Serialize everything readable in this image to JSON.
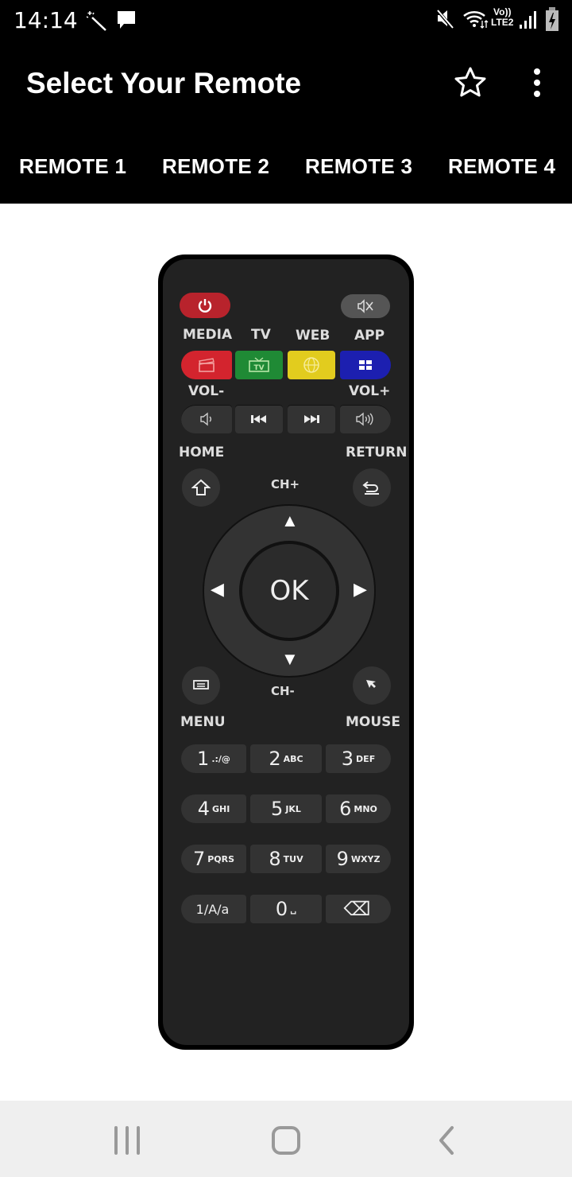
{
  "status_bar": {
    "time": "14:14",
    "left_icons": [
      "magic-wand-icon",
      "message-icon"
    ],
    "right_icons": [
      "mute-icon",
      "wifi-icon",
      "volte-lte2-icon",
      "signal-icon",
      "battery-charging-icon"
    ],
    "network_label_top": "Vo))",
    "network_label_bottom": "LTE2"
  },
  "app_bar": {
    "title": "Select Your Remote",
    "actions": [
      "star-icon",
      "more-vert-icon"
    ]
  },
  "tabs": [
    {
      "label": "REMOTE 1"
    },
    {
      "label": "REMOTE 2"
    },
    {
      "label": "REMOTE 3"
    },
    {
      "label": "REMOTE 4"
    }
  ],
  "remote": {
    "labels": {
      "media": "MEDIA",
      "tv": "TV",
      "web": "WEB",
      "app": "APP",
      "vol_minus": "VOL-",
      "vol_plus": "VOL+",
      "home": "HOME",
      "return": "RETURN",
      "ch_plus": "CH+",
      "ch_minus": "CH-",
      "menu": "MENU",
      "mouse": "MOUSE",
      "ok": "OK"
    },
    "color_buttons": [
      {
        "name": "media",
        "color": "#d3242e"
      },
      {
        "name": "tv",
        "color": "#1f8a35"
      },
      {
        "name": "web",
        "color": "#e2cc1e"
      },
      {
        "name": "app",
        "color": "#1c1fb0"
      }
    ],
    "power_color": "#b8232c",
    "keypad": [
      {
        "digit": "1",
        "sub": ".:/@"
      },
      {
        "digit": "2",
        "sub": "ABC"
      },
      {
        "digit": "3",
        "sub": "DEF"
      },
      {
        "digit": "4",
        "sub": "GHI"
      },
      {
        "digit": "5",
        "sub": "JKL"
      },
      {
        "digit": "6",
        "sub": "MNO"
      },
      {
        "digit": "7",
        "sub": "PQRS"
      },
      {
        "digit": "8",
        "sub": "TUV"
      },
      {
        "digit": "9",
        "sub": "WXYZ"
      },
      {
        "digit": "1/A/a",
        "sub": ""
      },
      {
        "digit": "0",
        "sub": "␣"
      },
      {
        "digit": "⌫",
        "sub": ""
      }
    ]
  },
  "nav_bar": {
    "buttons": [
      "recents-icon",
      "home-icon",
      "back-icon"
    ]
  }
}
